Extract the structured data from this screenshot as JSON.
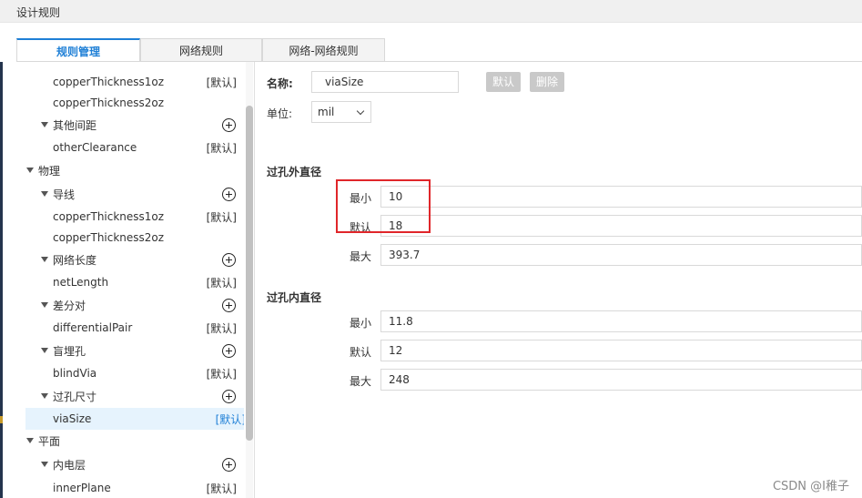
{
  "window": {
    "title": "设计规则"
  },
  "tabs": [
    {
      "label": "规则管理",
      "active": true
    },
    {
      "label": "网络规则",
      "active": false
    },
    {
      "label": "网络-网络规则",
      "active": false
    }
  ],
  "tree": {
    "rows": [
      {
        "label": "copperThickness1oz",
        "badge": "[默认]"
      },
      {
        "label": "copperThickness2oz"
      },
      {
        "label": "其他间距",
        "expandable": true
      },
      {
        "label": "otherClearance",
        "badge": "[默认]"
      },
      {
        "label": "物理",
        "expandable": true
      },
      {
        "label": "导线",
        "expandable": true
      },
      {
        "label": "copperThickness1oz",
        "badge": "[默认]"
      },
      {
        "label": "copperThickness2oz"
      },
      {
        "label": "网络长度",
        "expandable": true
      },
      {
        "label": "netLength",
        "badge": "[默认]"
      },
      {
        "label": "差分对",
        "expandable": true
      },
      {
        "label": "differentialPair",
        "badge": "[默认]"
      },
      {
        "label": "盲埋孔",
        "expandable": true
      },
      {
        "label": "blindVia",
        "badge": "[默认]"
      },
      {
        "label": "过孔尺寸",
        "expandable": true
      },
      {
        "label": "viaSize",
        "badge": "[默认]",
        "selected": true
      },
      {
        "label": "平面",
        "expandable": true
      },
      {
        "label": "内电层",
        "expandable": true
      },
      {
        "label": "innerPlane",
        "badge": "[默认]"
      }
    ]
  },
  "form": {
    "name_label": "名称:",
    "name_value": "viaSize",
    "default_button": "默认",
    "delete_button": "删除",
    "unit_label": "单位:",
    "unit_value": "mil",
    "outer": {
      "title": "过孔外直径",
      "min_label": "最小",
      "min_value": "10",
      "default_label": "默认",
      "default_value": "18",
      "max_label": "最大",
      "max_value": "393.7"
    },
    "inner": {
      "title": "过孔内直径",
      "min_label": "最小",
      "min_value": "11.8",
      "default_label": "默认",
      "default_value": "12",
      "max_label": "最大",
      "max_value": "248"
    }
  },
  "watermark": "CSDN @I稚子",
  "colors": {
    "accent": "#1e7fd6",
    "highlight_box": "#e0262a",
    "selected_row": "#e6f3fd"
  }
}
